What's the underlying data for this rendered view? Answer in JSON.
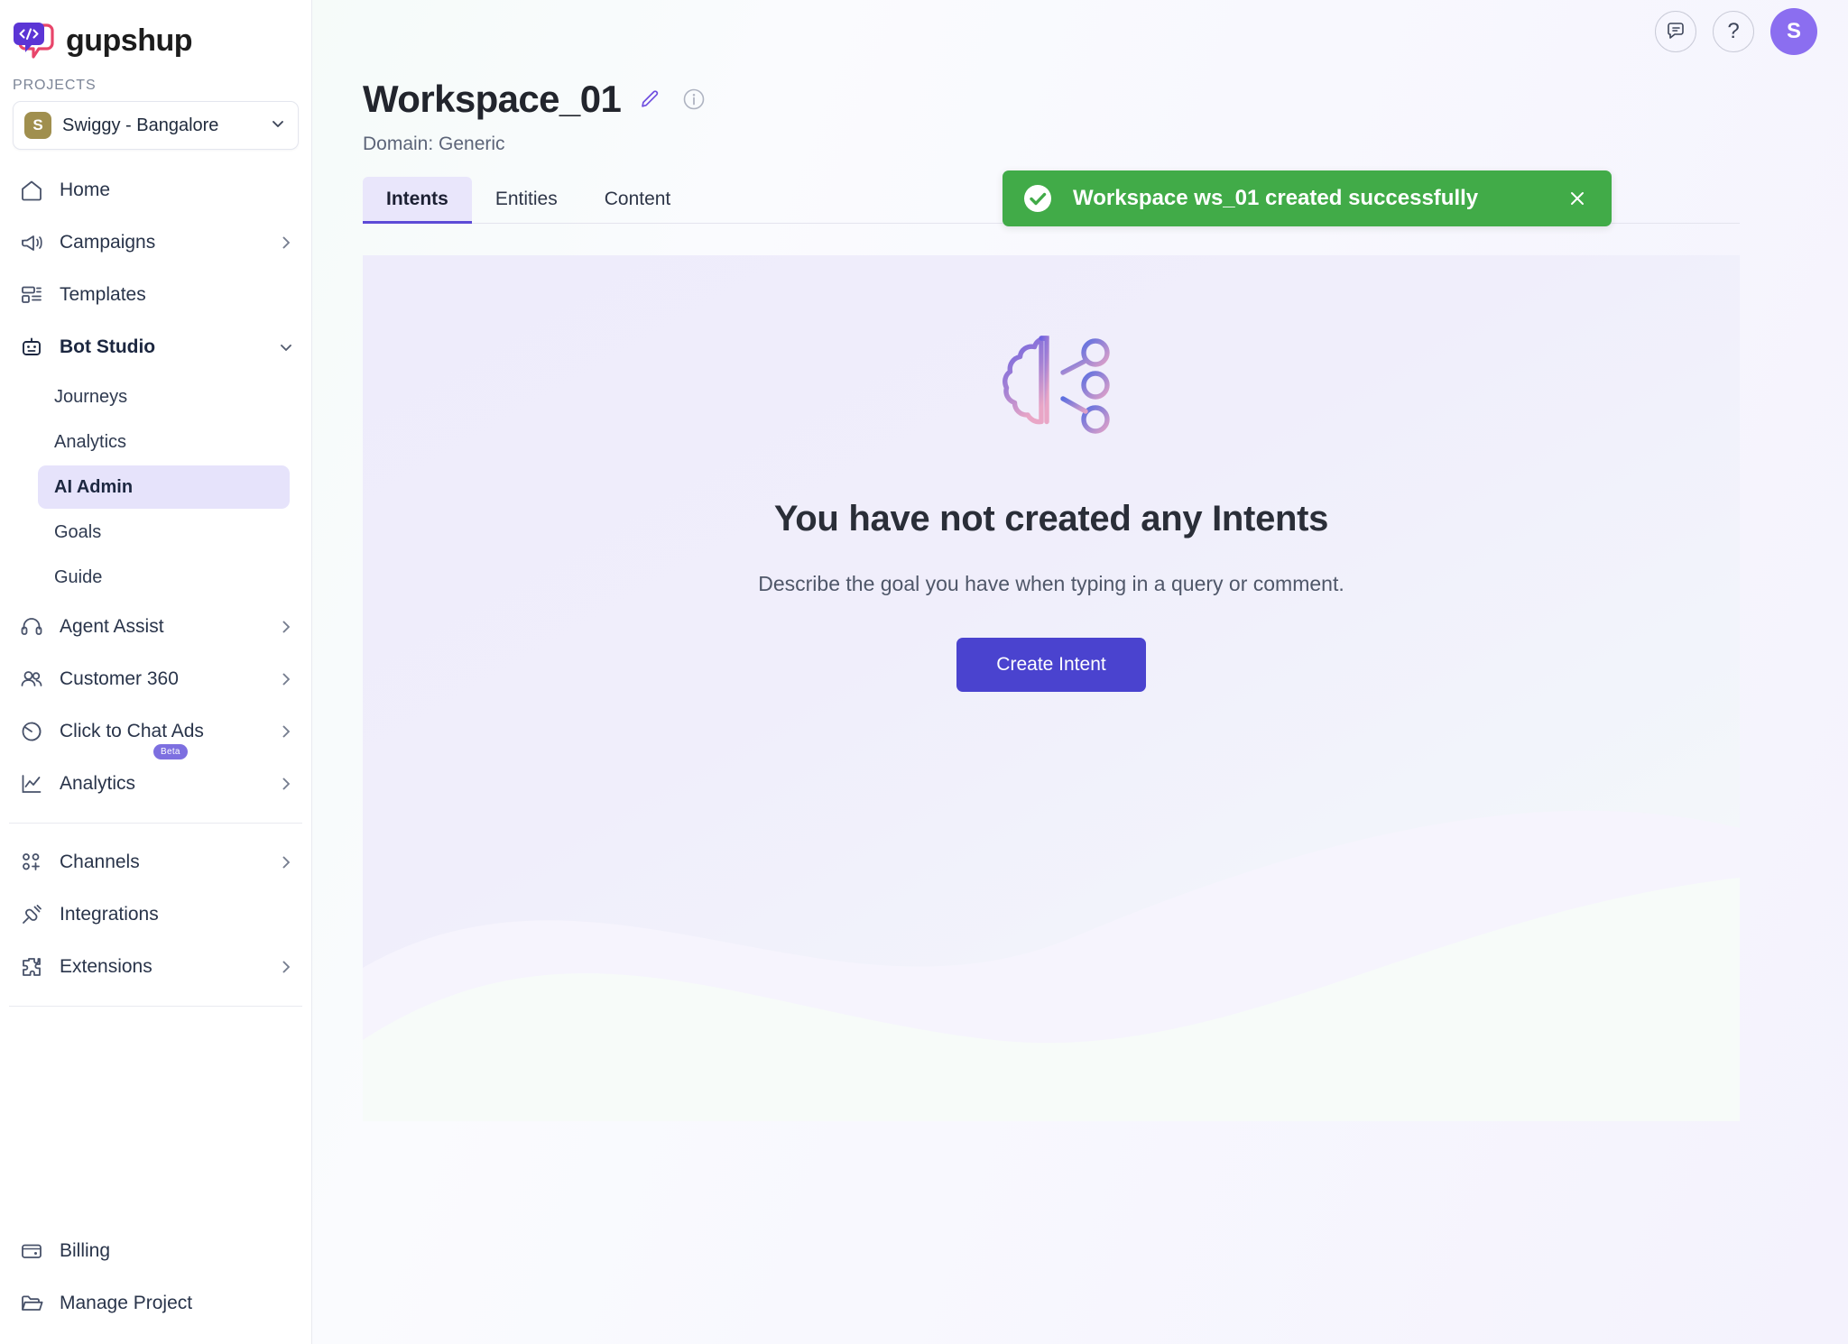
{
  "brand": {
    "name": "gupshup",
    "logo_icon": "gupshup-code-bubble-logo",
    "accent_purple": "#5d4ad6",
    "accent_pink": "#e8456a"
  },
  "sidebar": {
    "projects_label": "PROJECTS",
    "project": {
      "initial": "S",
      "name": "Swiggy - Bangalore",
      "avatar_color": "#a08f4e",
      "chevron_icon": "chevron-down-icon"
    },
    "items": [
      {
        "label": "Home",
        "icon": "home-icon",
        "has_chevron": false
      },
      {
        "label": "Campaigns",
        "icon": "megaphone-icon",
        "has_chevron": true
      },
      {
        "label": "Templates",
        "icon": "templates-icon",
        "has_chevron": false
      },
      {
        "label": "Bot Studio",
        "icon": "robot-icon",
        "has_chevron": true,
        "expanded": true
      }
    ],
    "bot_studio_children": [
      {
        "label": "Journeys",
        "active": false
      },
      {
        "label": "Analytics",
        "active": false
      },
      {
        "label": "AI Admin",
        "active": true
      },
      {
        "label": "Goals",
        "active": false
      },
      {
        "label": "Guide",
        "active": false
      }
    ],
    "items_after": [
      {
        "label": "Agent Assist",
        "icon": "headset-icon",
        "has_chevron": true
      },
      {
        "label": "Customer 360",
        "icon": "users-icon",
        "has_chevron": true
      },
      {
        "label": "Click to Chat Ads",
        "icon": "pie-chart-icon",
        "has_chevron": true,
        "badge": "Beta"
      },
      {
        "label": "Analytics",
        "icon": "line-chart-icon",
        "has_chevron": true
      }
    ],
    "items_group_two": [
      {
        "label": "Channels",
        "icon": "channels-icon",
        "has_chevron": true
      },
      {
        "label": "Integrations",
        "icon": "plug-icon",
        "has_chevron": false
      },
      {
        "label": "Extensions",
        "icon": "puzzle-icon",
        "has_chevron": true
      }
    ],
    "items_bottom": [
      {
        "label": "Billing",
        "icon": "wallet-icon",
        "has_chevron": false
      },
      {
        "label": "Manage Project",
        "icon": "folder-icon",
        "has_chevron": false
      }
    ],
    "active_item": "AI Admin",
    "badge_color": "#7d6fe0"
  },
  "topbar": {
    "feedback_icon": "chat-bubble-icon",
    "help_icon": "question-mark-icon",
    "help_label": "?",
    "avatar_initial": "S",
    "avatar_color": "#8b6ef0"
  },
  "page": {
    "title": "Workspace_01",
    "edit_icon": "pencil-edit-icon",
    "info_icon": "info-circle-icon",
    "domain_line": "Domain: Generic",
    "tabs": [
      {
        "label": "Intents",
        "active": true
      },
      {
        "label": "Entities",
        "active": false
      },
      {
        "label": "Content",
        "active": false
      }
    ]
  },
  "empty_state": {
    "illustration_icon": "brain-network-icon",
    "title": "You have not created any Intents",
    "subtitle": "Describe the goal you have when typing in a query or comment.",
    "cta_label": "Create Intent",
    "cta_color": "#4a43cf"
  },
  "toast": {
    "message": "Workspace ws_01 created successfully",
    "status_icon": "check-circle-icon",
    "close_icon": "close-x-icon",
    "background_color": "#41ab48"
  }
}
